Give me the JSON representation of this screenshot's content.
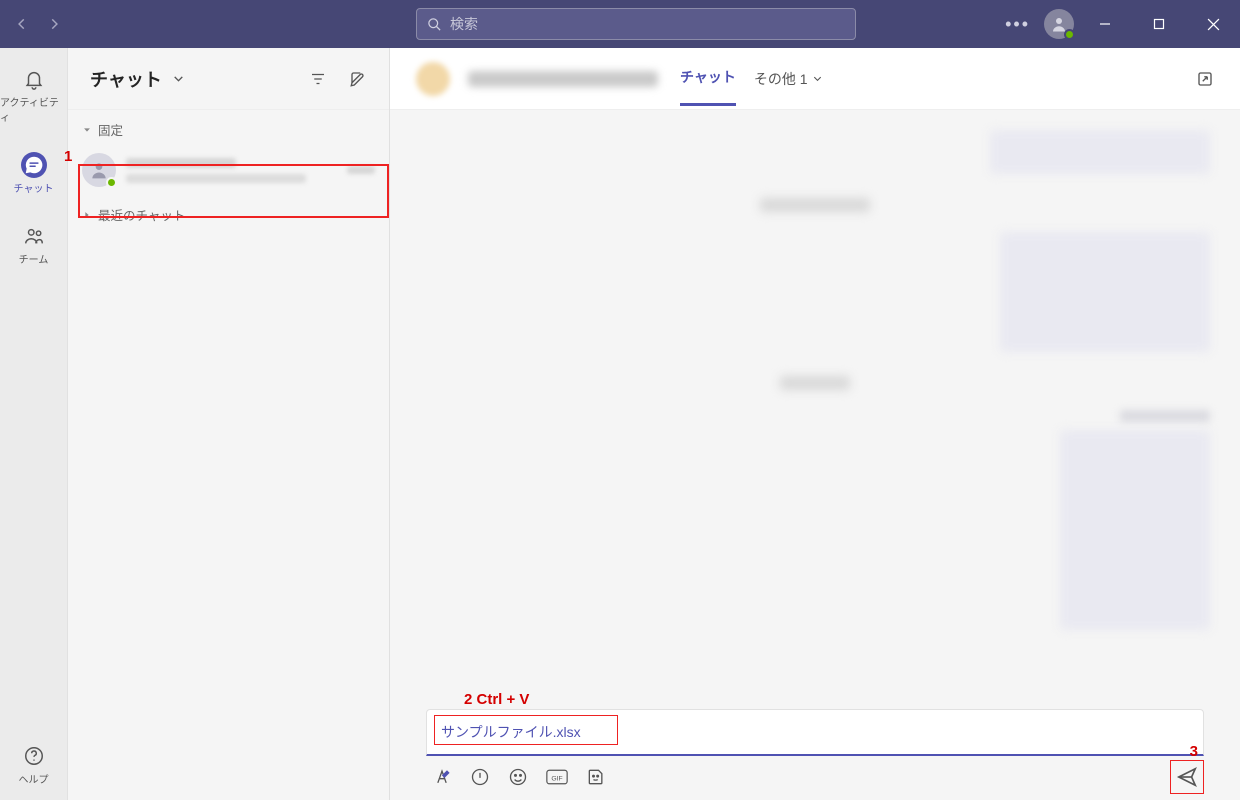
{
  "titlebar": {
    "search_placeholder": "検索"
  },
  "apprail": {
    "activity": "アクティビティ",
    "chat": "チャット",
    "teams": "チーム",
    "help": "ヘルプ"
  },
  "chatlist": {
    "title": "チャット",
    "section_pinned": "固定",
    "section_recent": "最近のチャット"
  },
  "mainheader": {
    "tab_chat": "チャット",
    "tab_other": "その他 1"
  },
  "compose": {
    "attachment_name": "サンプルファイル.xlsx"
  },
  "annotations": {
    "a1": "1",
    "a2": "2 Ctrl + V",
    "a3": "3"
  }
}
